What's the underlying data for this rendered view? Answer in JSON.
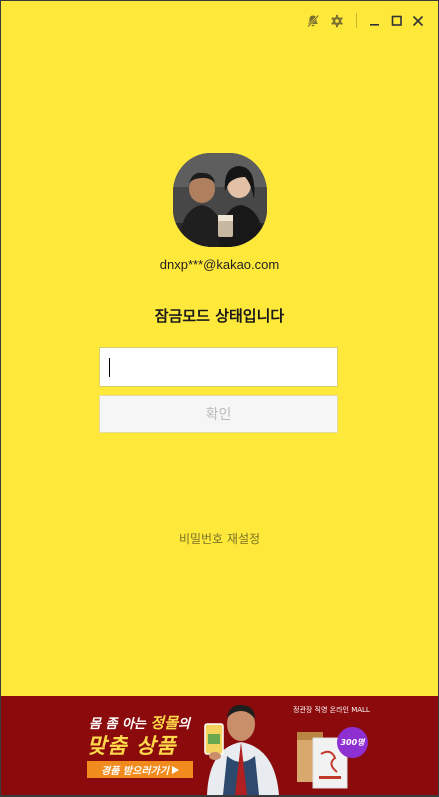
{
  "window": {
    "controls": {
      "mute_icon": "bell-off-icon",
      "settings_icon": "gear-icon",
      "minimize_icon": "minimize-icon",
      "maximize_icon": "maximize-icon",
      "close_icon": "close-icon"
    }
  },
  "profile": {
    "email": "dnxp***@kakao.com"
  },
  "lock": {
    "status_text": "잠금모드 상태입니다",
    "password_placeholder": "",
    "confirm_label": "확인",
    "reset_password_label": "비밀번호 재설정"
  },
  "ad": {
    "line1_pre": "몸 좀 아는 ",
    "line1_highlight": "정몰",
    "line1_post": "의",
    "line2": "맞춤 상품",
    "cta_label": "경품 받으러가기",
    "mall_label": "정관장 직영 온라인 MALL",
    "badge": "300명"
  },
  "colors": {
    "background": "#FEE93B",
    "ad_background": "#8b0a0b",
    "ad_accent": "#ffd94a",
    "ad_cta": "#f28b1e"
  }
}
